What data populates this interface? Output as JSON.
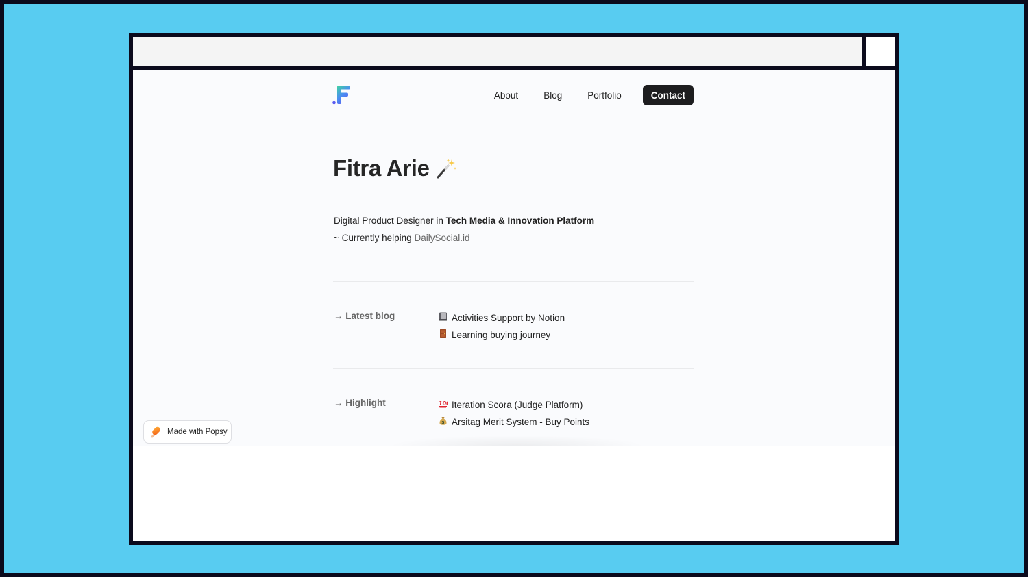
{
  "nav": {
    "logo_letter": "F",
    "links": [
      {
        "label": "About"
      },
      {
        "label": "Blog"
      },
      {
        "label": "Portfolio"
      }
    ],
    "cta_label": "Contact"
  },
  "hero": {
    "title": "Fitra Arie",
    "title_icon": "magic-wand-emoji",
    "bio_line1_prefix": "Digital Product Designer in ",
    "bio_line1_bold": "Tech Media & Innovation Platform",
    "bio_line2_prefix": "~ Currently helping ",
    "bio_line2_link": "DailySocial.id"
  },
  "sections": [
    {
      "label": "→ Latest blog",
      "items": [
        {
          "icon": "notebook-emoji",
          "text": "Activities Support by Notion"
        },
        {
          "icon": "door-emoji",
          "text": "Learning buying journey"
        }
      ]
    },
    {
      "label": "→ Highlight",
      "items": [
        {
          "icon": "hundred-points-emoji",
          "text": "Iteration Scora (Judge Platform)"
        },
        {
          "icon": "money-bag-emoji",
          "text": "Arsitag Merit System - Buy Points"
        }
      ]
    }
  ],
  "badge": {
    "label": "Made with Popsy",
    "icon": "popsicle-icon"
  },
  "colors": {
    "backdrop": "#58ccf1",
    "frame": "#0b0a1c",
    "cta_bg": "#1d1d1f",
    "page_bg": "#fafbfd"
  }
}
